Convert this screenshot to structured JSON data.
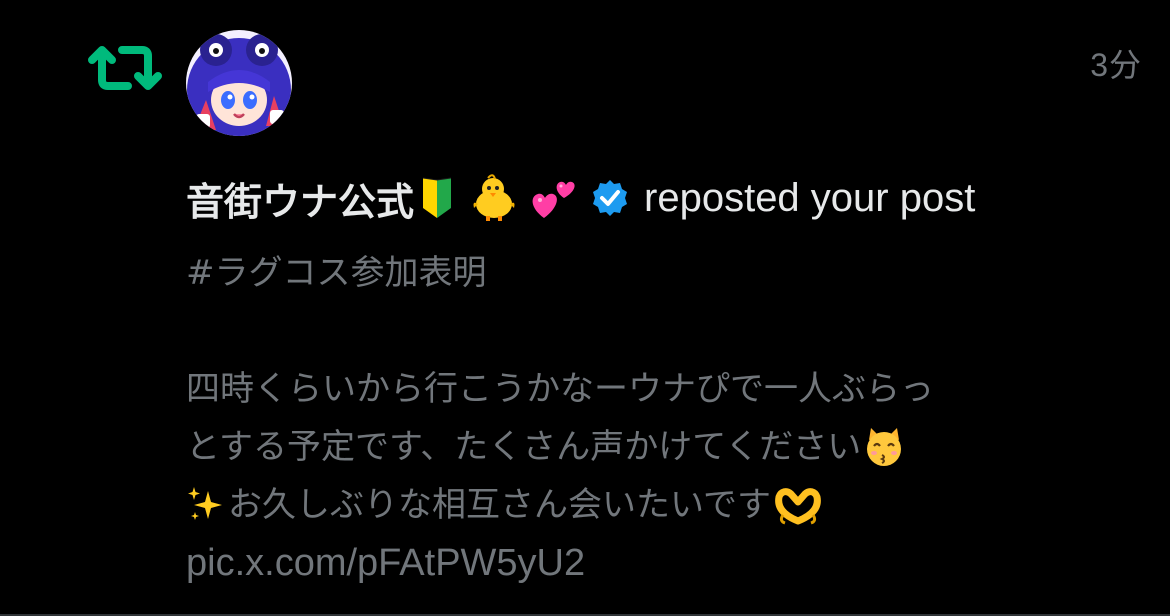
{
  "notification": {
    "icon": "repost-icon",
    "icon_color": "#00ba7c",
    "timestamp": "3分",
    "avatar": "user-avatar",
    "display_name": "音街ウナ公式",
    "name_emojis": [
      "beginner-badge-icon",
      "chick-icon",
      "two-hearts-icon"
    ],
    "verified_badge": "verified-badge-icon",
    "verified_color": "#1d9bf0",
    "action_text": "reposted your post"
  },
  "post": {
    "hashtag": "#ラグコス参加表明",
    "line1": "四時くらいから行こうかなーウナぴで一人ぶらっ",
    "line2": "とする予定です、たくさん声かけてください",
    "line2_emoji": "kissing-cat-icon",
    "line3_emoji": "sparkles-icon",
    "line3": "お久しぶりな相互さん会いたいです",
    "line3_end_emoji": "heart-hands-icon",
    "link": "pic.x.com/pFAtPW5yU2"
  },
  "colors": {
    "background": "#000000",
    "primary_text": "#e7e9ea",
    "secondary_text": "#71767b"
  }
}
